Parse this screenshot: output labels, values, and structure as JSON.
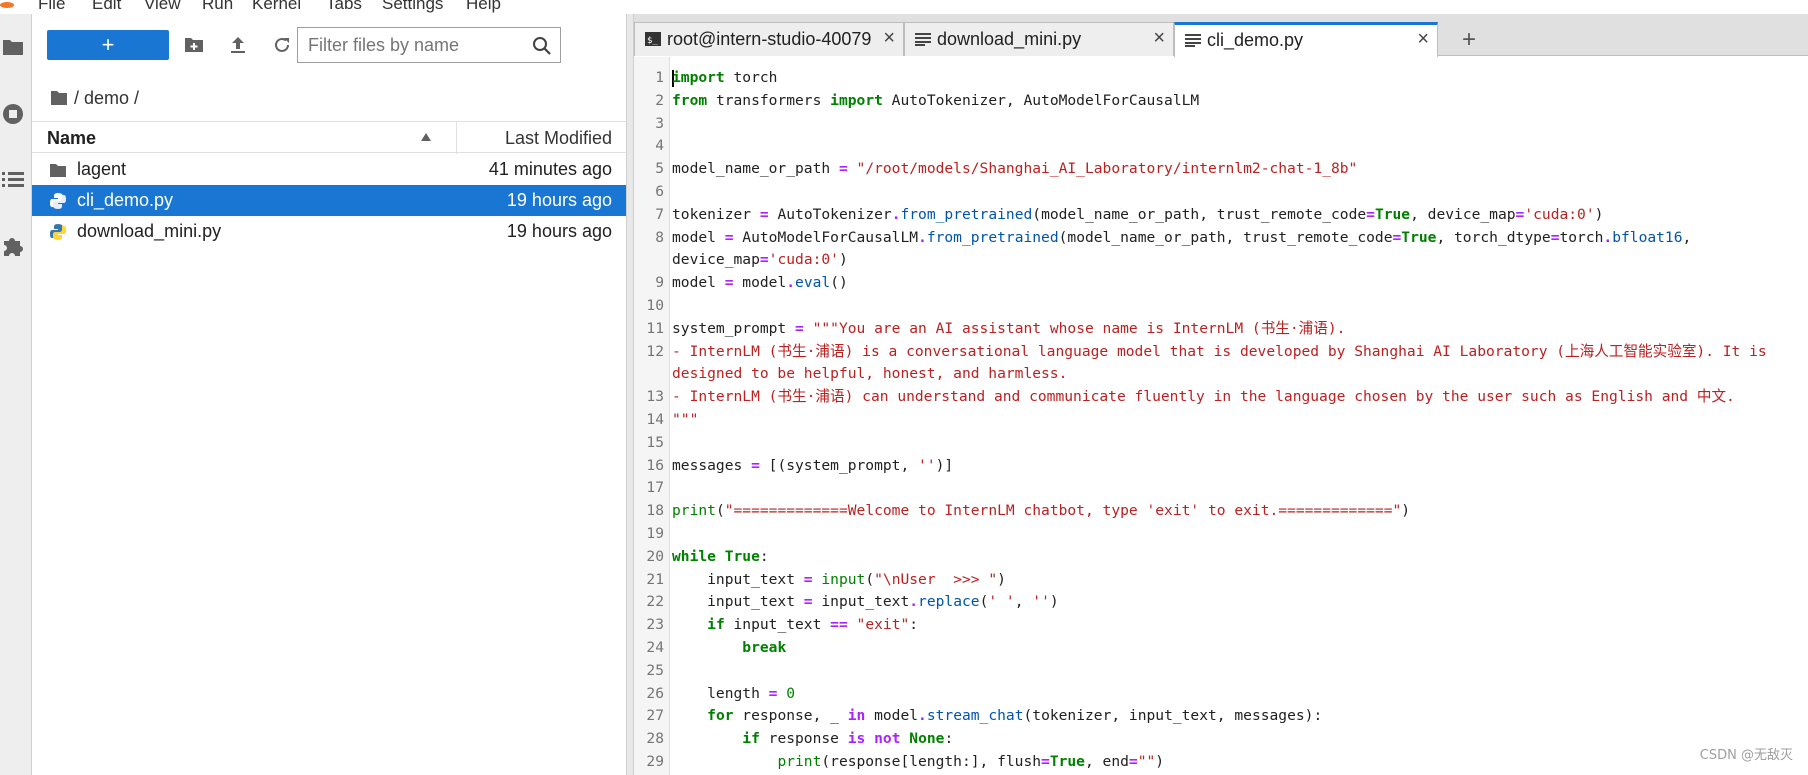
{
  "menu": [
    "File",
    "Edit",
    "View",
    "Run",
    "Kernel",
    "Tabs",
    "Settings",
    "Help"
  ],
  "activity": [
    "folder-icon",
    "running-icon",
    "toc-icon",
    "extension-icon"
  ],
  "filebrowser": {
    "new_label": "+",
    "filter_placeholder": "Filter files by name",
    "breadcrumb": "/ demo /",
    "col_name": "Name",
    "col_modified": "Last Modified",
    "files": [
      {
        "name": "lagent",
        "modified": "41 minutes ago",
        "type": "folder",
        "selected": false
      },
      {
        "name": "cli_demo.py",
        "modified": "19 hours ago",
        "type": "python",
        "selected": true
      },
      {
        "name": "download_mini.py",
        "modified": "19 hours ago",
        "type": "python",
        "selected": false
      }
    ]
  },
  "tabs": [
    {
      "label": "root@intern-studio-40079",
      "icon": "terminal-icon",
      "active": false
    },
    {
      "label": "download_mini.py",
      "icon": "text-file-icon",
      "active": false
    },
    {
      "label": "cli_demo.py",
      "icon": "text-file-icon",
      "active": true
    }
  ],
  "add_tab": "+",
  "code_lines": [
    {
      "n": "1",
      "t": [
        [
          "k",
          "import"
        ],
        [
          "p",
          " torch"
        ]
      ]
    },
    {
      "n": "2",
      "t": [
        [
          "k",
          "from"
        ],
        [
          "p",
          " transformers "
        ],
        [
          "k",
          "import"
        ],
        [
          "p",
          " AutoTokenizer, AutoModelForCausalLM"
        ]
      ]
    },
    {
      "n": "3",
      "t": []
    },
    {
      "n": "4",
      "t": []
    },
    {
      "n": "5",
      "t": [
        [
          "p",
          "model_name_or_path "
        ],
        [
          "o",
          "="
        ],
        [
          "p",
          " "
        ],
        [
          "s",
          "\"/root/models/Shanghai_AI_Laboratory/internlm2-chat-1_8b\""
        ]
      ]
    },
    {
      "n": "6",
      "t": []
    },
    {
      "n": "7",
      "t": [
        [
          "p",
          "tokenizer "
        ],
        [
          "o",
          "="
        ],
        [
          "p",
          " AutoTokenizer"
        ],
        [
          "o",
          "."
        ],
        [
          "a",
          "from_pretrained"
        ],
        [
          "p",
          "(model_name_or_path, trust_remote_code"
        ],
        [
          "o",
          "="
        ],
        [
          "k",
          "True"
        ],
        [
          "p",
          ", device_map"
        ],
        [
          "o",
          "="
        ],
        [
          "s",
          "'cuda:0'"
        ],
        [
          "p",
          ")"
        ]
      ]
    },
    {
      "n": "8",
      "t": [
        [
          "p",
          "model "
        ],
        [
          "o",
          "="
        ],
        [
          "p",
          " AutoModelForCausalLM"
        ],
        [
          "o",
          "."
        ],
        [
          "a",
          "from_pretrained"
        ],
        [
          "p",
          "(model_name_or_path, trust_remote_code"
        ],
        [
          "o",
          "="
        ],
        [
          "k",
          "True"
        ],
        [
          "p",
          ", torch_dtype"
        ],
        [
          "o",
          "="
        ],
        [
          "p",
          "torch"
        ],
        [
          "o",
          "."
        ],
        [
          "a",
          "bfloat16"
        ],
        [
          "p",
          ","
        ]
      ]
    },
    {
      "n": "",
      "t": [
        [
          "p",
          "device_map"
        ],
        [
          "o",
          "="
        ],
        [
          "s",
          "'cuda:0'"
        ],
        [
          "p",
          ")"
        ]
      ]
    },
    {
      "n": "9",
      "t": [
        [
          "p",
          "model "
        ],
        [
          "o",
          "="
        ],
        [
          "p",
          " model"
        ],
        [
          "o",
          "."
        ],
        [
          "a",
          "eval"
        ],
        [
          "p",
          "()"
        ]
      ]
    },
    {
      "n": "10",
      "t": []
    },
    {
      "n": "11",
      "t": [
        [
          "p",
          "system_prompt "
        ],
        [
          "o",
          "="
        ],
        [
          "p",
          " "
        ],
        [
          "s",
          "\"\"\"You are an AI assistant whose name is InternLM (书生·浦语)."
        ]
      ]
    },
    {
      "n": "12",
      "t": [
        [
          "s",
          "- InternLM (书生·浦语) is a conversational language model that is developed by Shanghai AI Laboratory (上海人工智能实验室). It is"
        ]
      ]
    },
    {
      "n": "",
      "t": [
        [
          "s",
          "designed to be helpful, honest, and harmless."
        ]
      ]
    },
    {
      "n": "13",
      "t": [
        [
          "s",
          "- InternLM (书生·浦语) can understand and communicate fluently in the language chosen by the user such as English and 中文."
        ]
      ]
    },
    {
      "n": "14",
      "t": [
        [
          "s",
          "\"\"\""
        ]
      ]
    },
    {
      "n": "15",
      "t": []
    },
    {
      "n": "16",
      "t": [
        [
          "p",
          "messages "
        ],
        [
          "o",
          "="
        ],
        [
          "p",
          " [(system_prompt, "
        ],
        [
          "s",
          "''"
        ],
        [
          "p",
          ")]"
        ]
      ]
    },
    {
      "n": "17",
      "t": []
    },
    {
      "n": "18",
      "t": [
        [
          "m",
          "print"
        ],
        [
          "p",
          "("
        ],
        [
          "s",
          "\"=============Welcome to InternLM chatbot, type 'exit' to exit.=============\""
        ],
        [
          "p",
          ")"
        ]
      ]
    },
    {
      "n": "19",
      "t": []
    },
    {
      "n": "20",
      "t": [
        [
          "k",
          "while"
        ],
        [
          "p",
          " "
        ],
        [
          "k",
          "True"
        ],
        [
          "p",
          ":"
        ]
      ]
    },
    {
      "n": "21",
      "t": [
        [
          "p",
          "    input_text "
        ],
        [
          "o",
          "="
        ],
        [
          "p",
          " "
        ],
        [
          "m",
          "input"
        ],
        [
          "p",
          "("
        ],
        [
          "s",
          "\"\\nUser  >>> \""
        ],
        [
          "p",
          ")"
        ]
      ]
    },
    {
      "n": "22",
      "t": [
        [
          "p",
          "    input_text "
        ],
        [
          "o",
          "="
        ],
        [
          "p",
          " input_text"
        ],
        [
          "o",
          "."
        ],
        [
          "a",
          "replace"
        ],
        [
          "p",
          "("
        ],
        [
          "s",
          "' '"
        ],
        [
          "p",
          ", "
        ],
        [
          "s",
          "''"
        ],
        [
          "p",
          ")"
        ]
      ]
    },
    {
      "n": "23",
      "t": [
        [
          "p",
          "    "
        ],
        [
          "k",
          "if"
        ],
        [
          "p",
          " input_text "
        ],
        [
          "o",
          "=="
        ],
        [
          "p",
          " "
        ],
        [
          "s",
          "\"exit\""
        ],
        [
          "p",
          ":"
        ]
      ]
    },
    {
      "n": "24",
      "t": [
        [
          "p",
          "        "
        ],
        [
          "k",
          "break"
        ]
      ]
    },
    {
      "n": "25",
      "t": []
    },
    {
      "n": "26",
      "t": [
        [
          "p",
          "    length "
        ],
        [
          "o",
          "="
        ],
        [
          "p",
          " "
        ],
        [
          "m",
          "0"
        ]
      ]
    },
    {
      "n": "27",
      "t": [
        [
          "p",
          "    "
        ],
        [
          "k",
          "for"
        ],
        [
          "p",
          " response, _ "
        ],
        [
          "o",
          "in"
        ],
        [
          "p",
          " model"
        ],
        [
          "o",
          "."
        ],
        [
          "a",
          "stream_chat"
        ],
        [
          "p",
          "(tokenizer, input_text, messages):"
        ]
      ]
    },
    {
      "n": "28",
      "t": [
        [
          "p",
          "        "
        ],
        [
          "k",
          "if"
        ],
        [
          "p",
          " response "
        ],
        [
          "o",
          "is"
        ],
        [
          "p",
          " "
        ],
        [
          "o",
          "not"
        ],
        [
          "p",
          " "
        ],
        [
          "k",
          "None"
        ],
        [
          "p",
          ":"
        ]
      ]
    },
    {
      "n": "29",
      "t": [
        [
          "p",
          "            "
        ],
        [
          "m",
          "print"
        ],
        [
          "p",
          "(response[length:], flush"
        ],
        [
          "o",
          "="
        ],
        [
          "k",
          "True"
        ],
        [
          "p",
          ", end"
        ],
        [
          "o",
          "="
        ],
        [
          "s",
          "\"\""
        ],
        [
          "p",
          ")"
        ]
      ]
    }
  ],
  "watermark": "CSDN @无敌灭"
}
